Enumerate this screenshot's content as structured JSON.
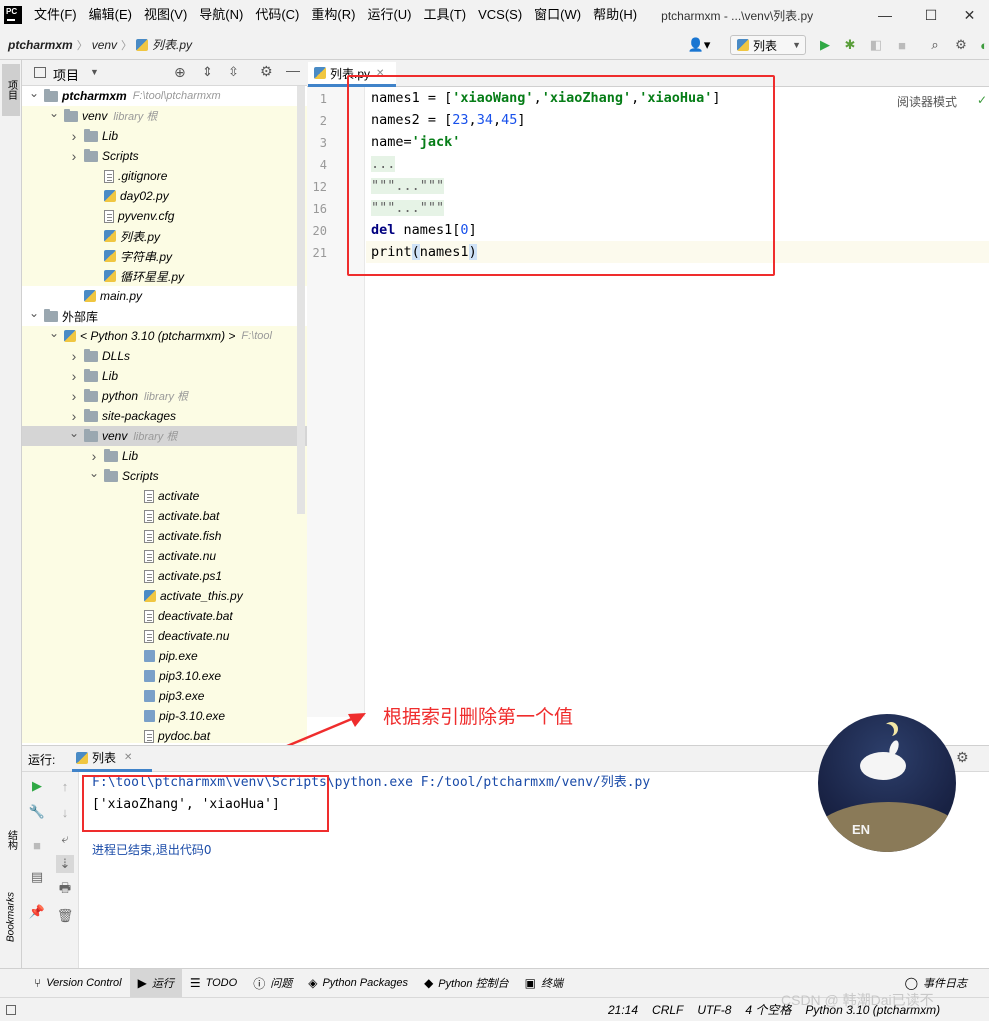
{
  "menubar": {
    "items": [
      "文件(F)",
      "编辑(E)",
      "视图(V)",
      "导航(N)",
      "代码(C)",
      "重构(R)",
      "运行(U)",
      "工具(T)",
      "VCS(S)",
      "窗口(W)",
      "帮助(H)"
    ],
    "window_title": "ptcharmxm - ...\\venv\\列表.py",
    "logo": "PC"
  },
  "navbar": {
    "crumbs": [
      "ptcharmxm",
      "venv",
      "列表.py"
    ],
    "run_config": "列表"
  },
  "project_panel": {
    "title": "项目",
    "tree": [
      {
        "label": "ptcharmxm",
        "sub": "F:\\tool\\ptcharmxm",
        "indent": 0,
        "type": "folder",
        "arrow": "open",
        "bold": true
      },
      {
        "label": "venv",
        "sub": "library 根",
        "indent": 1,
        "type": "folder",
        "arrow": "open"
      },
      {
        "label": "Lib",
        "sub": "",
        "indent": 2,
        "type": "folder",
        "arrow": "closed"
      },
      {
        "label": "Scripts",
        "sub": "",
        "indent": 2,
        "type": "folder",
        "arrow": "closed"
      },
      {
        "label": ".gitignore",
        "sub": "",
        "indent": 3,
        "type": "txt"
      },
      {
        "label": "day02.py",
        "sub": "",
        "indent": 3,
        "type": "py"
      },
      {
        "label": "pyvenv.cfg",
        "sub": "",
        "indent": 3,
        "type": "txt"
      },
      {
        "label": "列表.py",
        "sub": "",
        "indent": 3,
        "type": "py"
      },
      {
        "label": "字符串.py",
        "sub": "",
        "indent": 3,
        "type": "py"
      },
      {
        "label": "循环星星.py",
        "sub": "",
        "indent": 3,
        "type": "py"
      },
      {
        "label": "main.py",
        "sub": "",
        "indent": 2,
        "type": "py"
      },
      {
        "label": "外部库",
        "sub": "",
        "indent": 0,
        "type": "lib",
        "arrow": "open"
      },
      {
        "label": "< Python 3.10 (ptcharmxm) >",
        "sub": "F:\\tool",
        "indent": 1,
        "type": "py",
        "arrow": "open"
      },
      {
        "label": "DLLs",
        "sub": "",
        "indent": 2,
        "type": "folder",
        "arrow": "closed"
      },
      {
        "label": "Lib",
        "sub": "",
        "indent": 2,
        "type": "folder",
        "arrow": "closed"
      },
      {
        "label": "python",
        "sub": "library 根",
        "indent": 2,
        "type": "folder",
        "arrow": "closed"
      },
      {
        "label": "site-packages",
        "sub": "",
        "indent": 2,
        "type": "folder",
        "arrow": "closed"
      },
      {
        "label": "venv",
        "sub": "library 根",
        "indent": 2,
        "type": "folder",
        "arrow": "open",
        "selected": true
      },
      {
        "label": "Lib",
        "sub": "",
        "indent": 3,
        "type": "folder",
        "arrow": "closed"
      },
      {
        "label": "Scripts",
        "sub": "",
        "indent": 3,
        "type": "folder",
        "arrow": "open"
      },
      {
        "label": "activate",
        "sub": "",
        "indent": 5,
        "type": "txt"
      },
      {
        "label": "activate.bat",
        "sub": "",
        "indent": 5,
        "type": "txt"
      },
      {
        "label": "activate.fish",
        "sub": "",
        "indent": 5,
        "type": "txt"
      },
      {
        "label": "activate.nu",
        "sub": "",
        "indent": 5,
        "type": "txt"
      },
      {
        "label": "activate.ps1",
        "sub": "",
        "indent": 5,
        "type": "txt"
      },
      {
        "label": "activate_this.py",
        "sub": "",
        "indent": 5,
        "type": "py"
      },
      {
        "label": "deactivate.bat",
        "sub": "",
        "indent": 5,
        "type": "txt"
      },
      {
        "label": "deactivate.nu",
        "sub": "",
        "indent": 5,
        "type": "txt"
      },
      {
        "label": "pip.exe",
        "sub": "",
        "indent": 5,
        "type": "exe"
      },
      {
        "label": "pip3.10.exe",
        "sub": "",
        "indent": 5,
        "type": "exe"
      },
      {
        "label": "pip3.exe",
        "sub": "",
        "indent": 5,
        "type": "exe"
      },
      {
        "label": "pip-3.10.exe",
        "sub": "",
        "indent": 5,
        "type": "exe"
      },
      {
        "label": "pydoc.bat",
        "sub": "",
        "indent": 5,
        "type": "txt"
      }
    ]
  },
  "editor": {
    "tab_label": "列表.py",
    "reader_mode": "阅读器模式",
    "line_numbers": [
      "1",
      "2",
      "3",
      "4",
      "12",
      "16",
      "20",
      "21"
    ]
  },
  "annotation": "根据索引删除第一个值",
  "run_panel": {
    "label": "运行:",
    "tab": "列表",
    "output_line1": "F:\\tool\\ptcharmxm\\venv\\Scripts\\python.exe F:/tool/ptcharmxm/venv/列表.py",
    "output_line2": "['xiaoZhang', 'xiaoHua']",
    "output_line3": "进程已结束,退出代码0"
  },
  "avatar_text": "EN",
  "left_strip": {
    "project": "项目",
    "structure": "结构",
    "bookmarks": "Bookmarks"
  },
  "tool_windows": [
    "Version Control",
    "运行",
    "TODO",
    "问题",
    "Python Packages",
    "Python 控制台",
    "终端",
    "事件日志"
  ],
  "status_bar": {
    "position": "21:14",
    "line_sep": "CRLF",
    "encoding": "UTF-8",
    "indent": "4 个空格",
    "interpreter": "Python 3.10 (ptcharmxm)"
  },
  "watermark": "CSDN @ 韩潮Dai已读不"
}
